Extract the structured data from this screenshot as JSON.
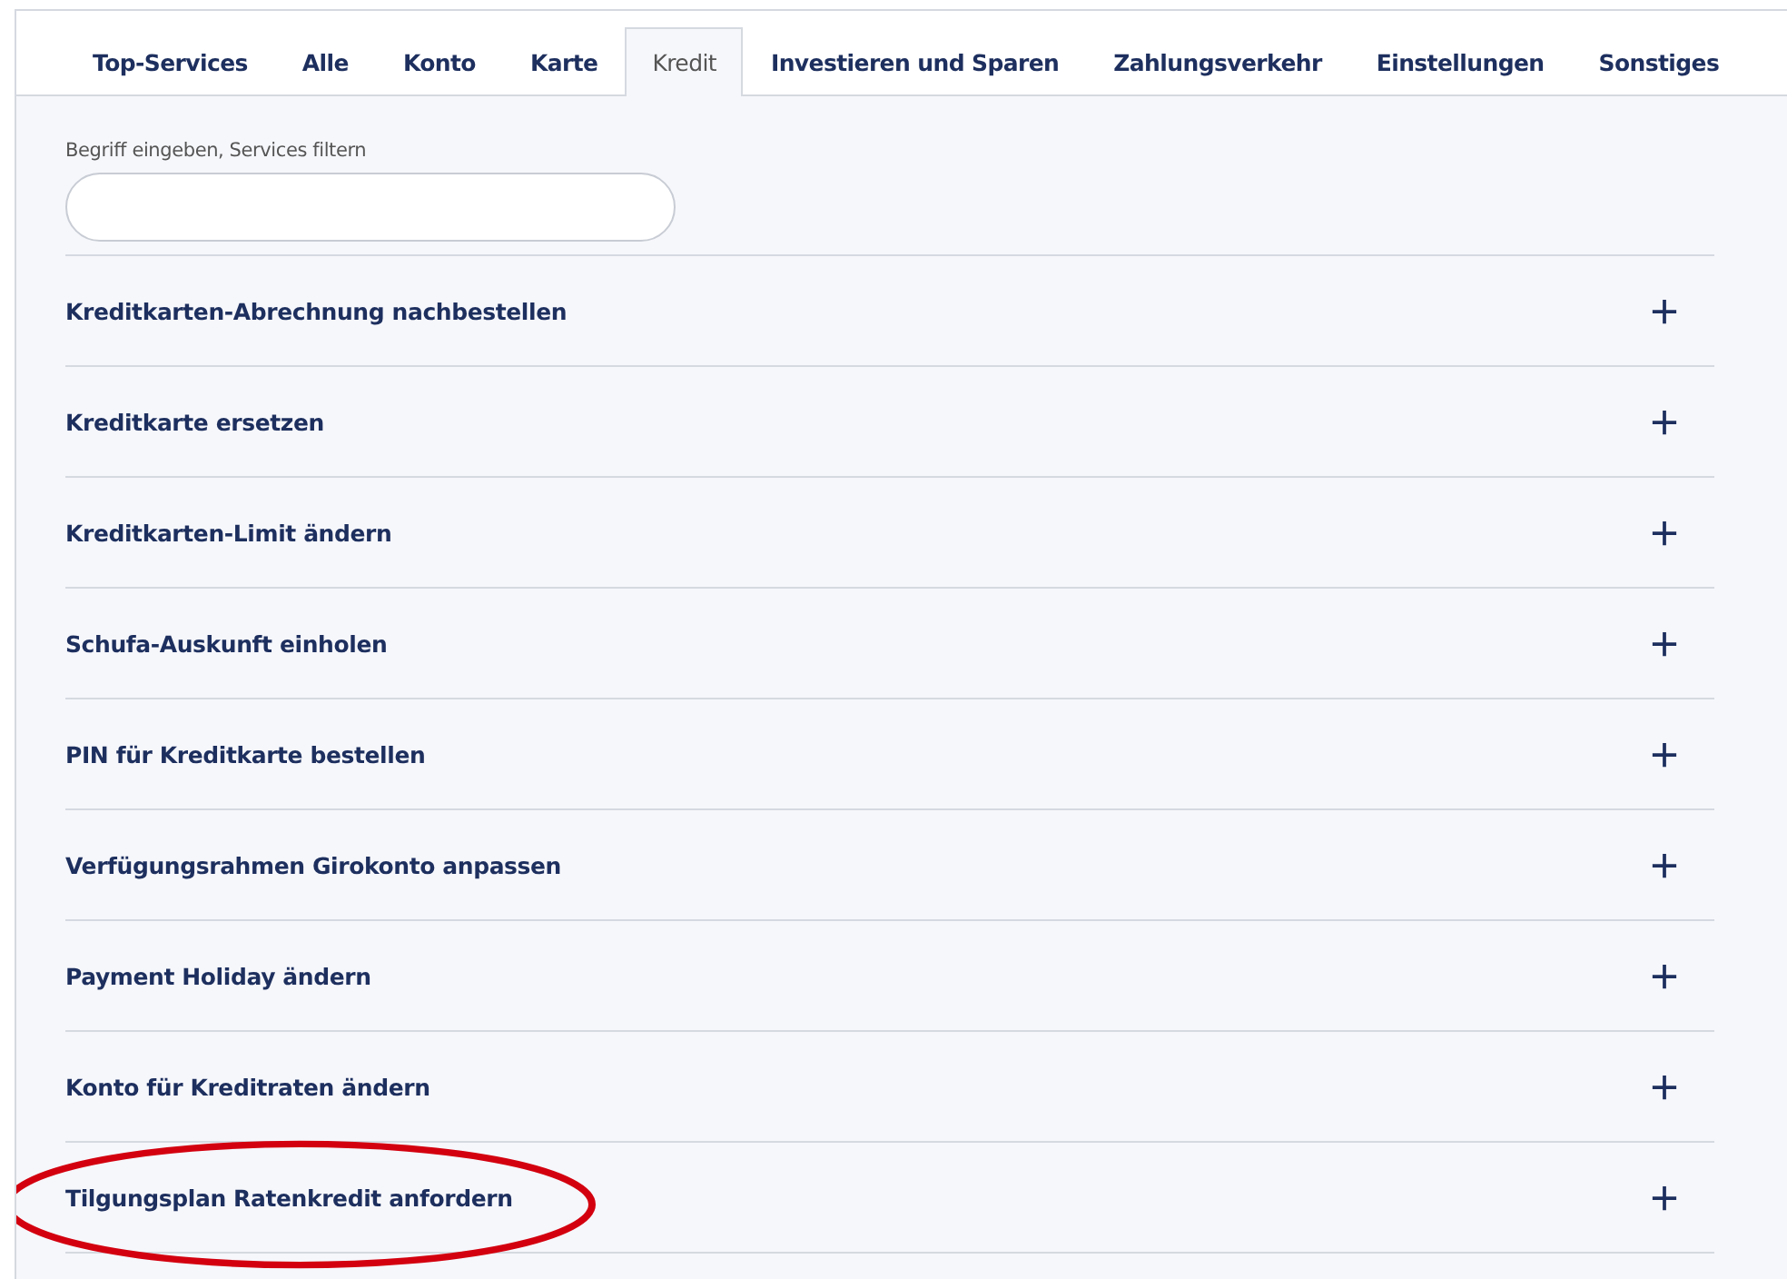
{
  "tabs": [
    {
      "label": "Top-Services",
      "selected": false
    },
    {
      "label": "Alle",
      "selected": false
    },
    {
      "label": "Konto",
      "selected": false
    },
    {
      "label": "Karte",
      "selected": false
    },
    {
      "label": "Kredit",
      "selected": true
    },
    {
      "label": "Investieren und Sparen",
      "selected": false
    },
    {
      "label": "Zahlungsverkehr",
      "selected": false
    },
    {
      "label": "Einstellungen",
      "selected": false
    },
    {
      "label": "Sonstiges",
      "selected": false
    }
  ],
  "filter": {
    "label": "Begriff eingeben, Services filtern"
  },
  "services": [
    {
      "label": "Kreditkarten-Abrechnung nachbestellen",
      "circled": false
    },
    {
      "label": "Kreditkarte ersetzen",
      "circled": false
    },
    {
      "label": "Kreditkarten-Limit ändern",
      "circled": false
    },
    {
      "label": "Schufa-Auskunft einholen",
      "circled": false
    },
    {
      "label": "PIN für Kreditkarte bestellen",
      "circled": false
    },
    {
      "label": "Verfügungsrahmen Girokonto anpassen",
      "circled": false
    },
    {
      "label": "Payment Holiday ändern",
      "circled": false
    },
    {
      "label": "Konto für Kreditraten ändern",
      "circled": false
    },
    {
      "label": "Tilgungsplan Ratenkredit anfordern",
      "circled": true
    }
  ]
}
